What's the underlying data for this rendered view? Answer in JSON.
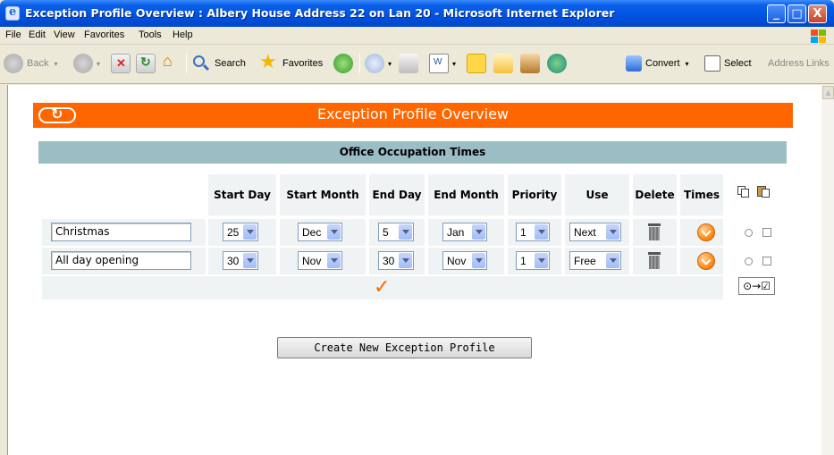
{
  "window": {
    "title": "Exception Profile Overview : Albery House Address 22 on Lan 20 - Microsoft Internet Explorer",
    "minimize": "_",
    "maximize": "□",
    "close": "X"
  },
  "menu": [
    "File",
    "Edit",
    "View",
    "Favorites",
    "Tools",
    "Help"
  ],
  "toolbar": {
    "back": "Back",
    "search": "Search",
    "favorites": "Favorites",
    "convert": "Convert",
    "select": "Select",
    "address": "Address",
    "links": "Links"
  },
  "page": {
    "header_title": "Exception Profile Overview",
    "section_title": "Office Occupation Times",
    "columns": [
      "Start Day",
      "Start Month",
      "End Day",
      "End Month",
      "Priority",
      "Use",
      "Delete",
      "Times"
    ],
    "rows": [
      {
        "name": "Christmas",
        "start_day": "25",
        "start_month": "Dec",
        "end_day": "5",
        "end_month": "Jan",
        "priority": "1",
        "use": "Next"
      },
      {
        "name": "All day opening",
        "start_day": "30",
        "start_month": "Nov",
        "end_day": "30",
        "end_month": "Nov",
        "priority": "1",
        "use": "Free"
      }
    ],
    "confirm_mark": "✓",
    "apply_button": "⊙→☑",
    "create_button": "Create New Exception Profile"
  },
  "colors": {
    "header_orange": "#ff6600",
    "section_teal": "#9bbdc4",
    "cell_bg": "#eff3f4"
  },
  "icons": [
    "refresh-icon",
    "copy-icon",
    "paste-icon",
    "trash-icon",
    "clock-icon",
    "checkmark-icon"
  ]
}
